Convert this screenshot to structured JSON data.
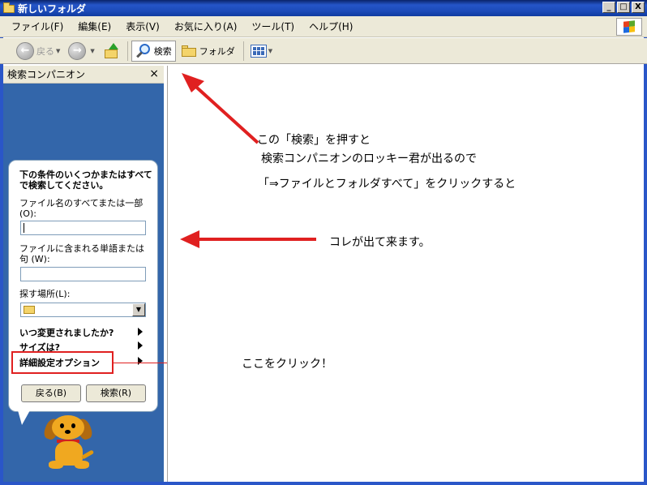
{
  "window": {
    "title": "新しいフォルダ",
    "buttons": {
      "minimize": "_",
      "maximize": "□",
      "close": "X"
    }
  },
  "menu": [
    "ファイル(F)",
    "編集(E)",
    "表示(V)",
    "お気に入り(A)",
    "ツール(T)",
    "ヘルプ(H)"
  ],
  "toolbar": {
    "back": "戻る",
    "search": "検索",
    "folders": "フォルダ"
  },
  "search_panel": {
    "title": "検索コンパニオン",
    "close": "×",
    "heading": "下の条件のいくつかまたはすべてで検索してください。",
    "filename_label": "ファイル名のすべてまたは一部 (O):",
    "filename_value": "",
    "word_label": "ファイルに含まれる単語または句 (W):",
    "word_value": "",
    "location_label": "探す場所(L):",
    "location_value": "",
    "when_modified": "いつ変更されましたか?",
    "size": "サイズは?",
    "advanced": "詳細設定オプション",
    "back_button": "戻る(B)",
    "search_button": "検索(R)"
  },
  "annotations": {
    "note1_line1": "この「検索」を押すと",
    "note1_line2": "検索コンパニオンのロッキー君が出るので",
    "note1_line3": "「⇒ファイルとフォルダすべて」をクリックすると",
    "note2": "コレが出て来ます。",
    "note3": "ここをクリック！"
  },
  "colors": {
    "titlebar": "#0a246a",
    "panel_background": "#3366aa",
    "annotation_red": "#e02020"
  }
}
